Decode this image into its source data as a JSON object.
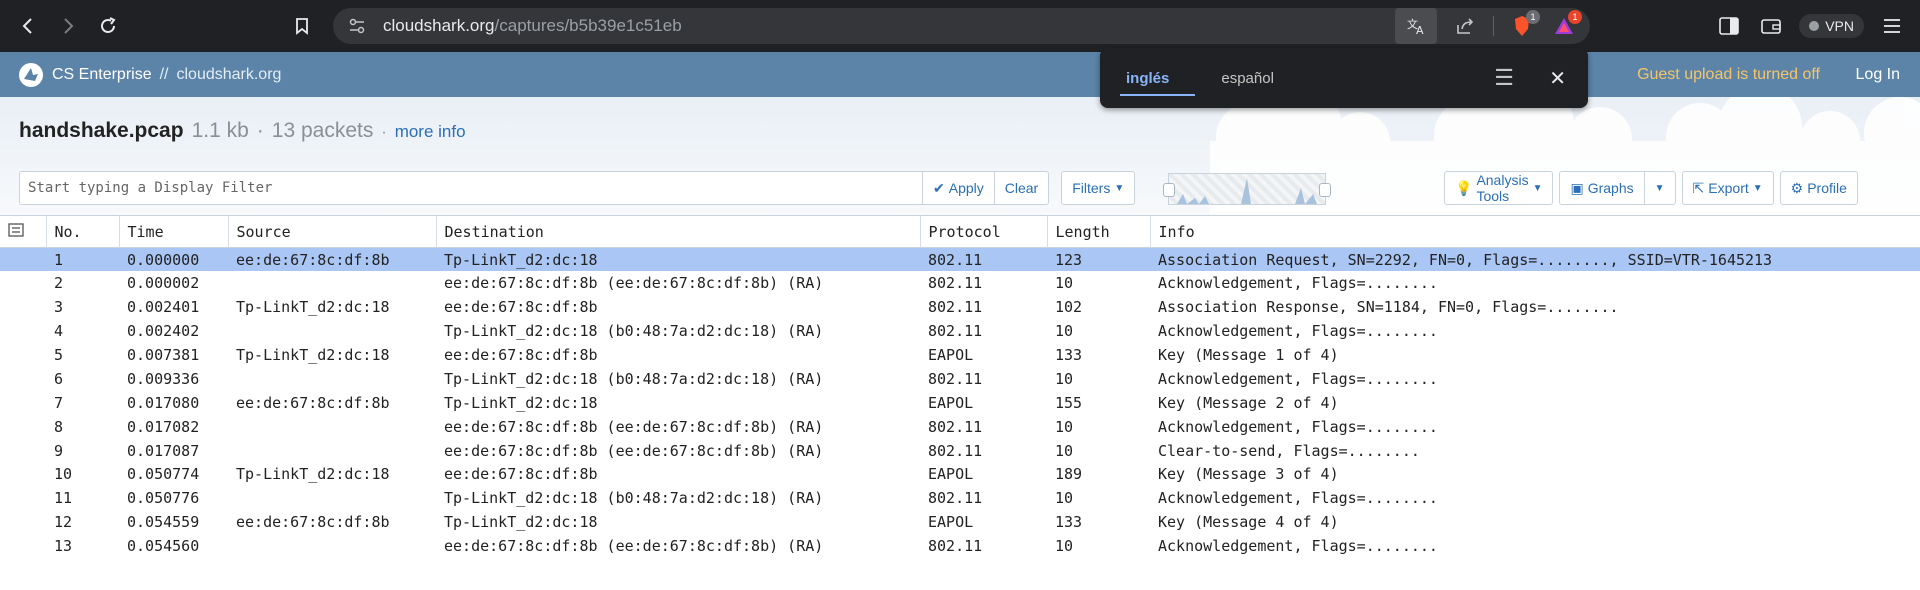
{
  "browser": {
    "url_domain": "cloudshark.org",
    "url_path": "/captures/b5b39e1c51eb",
    "brave_badge": "1",
    "alert_badge": "1",
    "vpn_label": "VPN"
  },
  "translate": {
    "tabs": [
      "inglés",
      "español"
    ]
  },
  "header": {
    "brand": "CS Enterprise",
    "separator": " // ",
    "site": "cloudshark.org",
    "guest_notice": "Guest upload is turned off",
    "login": "Log In"
  },
  "file": {
    "name": "handshake.pcap",
    "size": "1.1 kb",
    "dot1": "·",
    "packets": "13 packets",
    "dot2": "·",
    "more_info": "more info"
  },
  "filter": {
    "placeholder": "Start typing a Display Filter",
    "apply": "Apply",
    "clear": "Clear",
    "filters": "Filters",
    "analysis_tools": "Analysis Tools",
    "graphs": "Graphs",
    "export": "Export",
    "profile": "Profile"
  },
  "table": {
    "columns": [
      "No.",
      "Time",
      "Source",
      "Destination",
      "Protocol",
      "Length",
      "Info"
    ],
    "rows": [
      [
        "1",
        "0.000000",
        "ee:de:67:8c:df:8b",
        "Tp-LinkT_d2:dc:18",
        "802.11",
        "123",
        "Association Request, SN=2292, FN=0, Flags=........, SSID=VTR-1645213"
      ],
      [
        "2",
        "0.000002",
        "",
        "ee:de:67:8c:df:8b (ee:de:67:8c:df:8b) (RA)",
        "802.11",
        "10",
        "Acknowledgement, Flags=........"
      ],
      [
        "3",
        "0.002401",
        "Tp-LinkT_d2:dc:18",
        "ee:de:67:8c:df:8b",
        "802.11",
        "102",
        "Association Response, SN=1184, FN=0, Flags=........"
      ],
      [
        "4",
        "0.002402",
        "",
        "Tp-LinkT_d2:dc:18 (b0:48:7a:d2:dc:18) (RA)",
        "802.11",
        "10",
        "Acknowledgement, Flags=........"
      ],
      [
        "5",
        "0.007381",
        "Tp-LinkT_d2:dc:18",
        "ee:de:67:8c:df:8b",
        "EAPOL",
        "133",
        "Key (Message 1 of 4)"
      ],
      [
        "6",
        "0.009336",
        "",
        "Tp-LinkT_d2:dc:18 (b0:48:7a:d2:dc:18) (RA)",
        "802.11",
        "10",
        "Acknowledgement, Flags=........"
      ],
      [
        "7",
        "0.017080",
        "ee:de:67:8c:df:8b",
        "Tp-LinkT_d2:dc:18",
        "EAPOL",
        "155",
        "Key (Message 2 of 4)"
      ],
      [
        "8",
        "0.017082",
        "",
        "ee:de:67:8c:df:8b (ee:de:67:8c:df:8b) (RA)",
        "802.11",
        "10",
        "Acknowledgement, Flags=........"
      ],
      [
        "9",
        "0.017087",
        "",
        "ee:de:67:8c:df:8b (ee:de:67:8c:df:8b) (RA)",
        "802.11",
        "10",
        "Clear-to-send, Flags=........"
      ],
      [
        "10",
        "0.050774",
        "Tp-LinkT_d2:dc:18",
        "ee:de:67:8c:df:8b",
        "EAPOL",
        "189",
        "Key (Message 3 of 4)"
      ],
      [
        "11",
        "0.050776",
        "",
        "Tp-LinkT_d2:dc:18 (b0:48:7a:d2:dc:18) (RA)",
        "802.11",
        "10",
        "Acknowledgement, Flags=........"
      ],
      [
        "12",
        "0.054559",
        "ee:de:67:8c:df:8b",
        "Tp-LinkT_d2:dc:18",
        "EAPOL",
        "133",
        "Key (Message 4 of 4)"
      ],
      [
        "13",
        "0.054560",
        "",
        "ee:de:67:8c:df:8b (ee:de:67:8c:df:8b) (RA)",
        "802.11",
        "10",
        "Acknowledgement, Flags=........"
      ]
    ],
    "selected_row": 1
  }
}
